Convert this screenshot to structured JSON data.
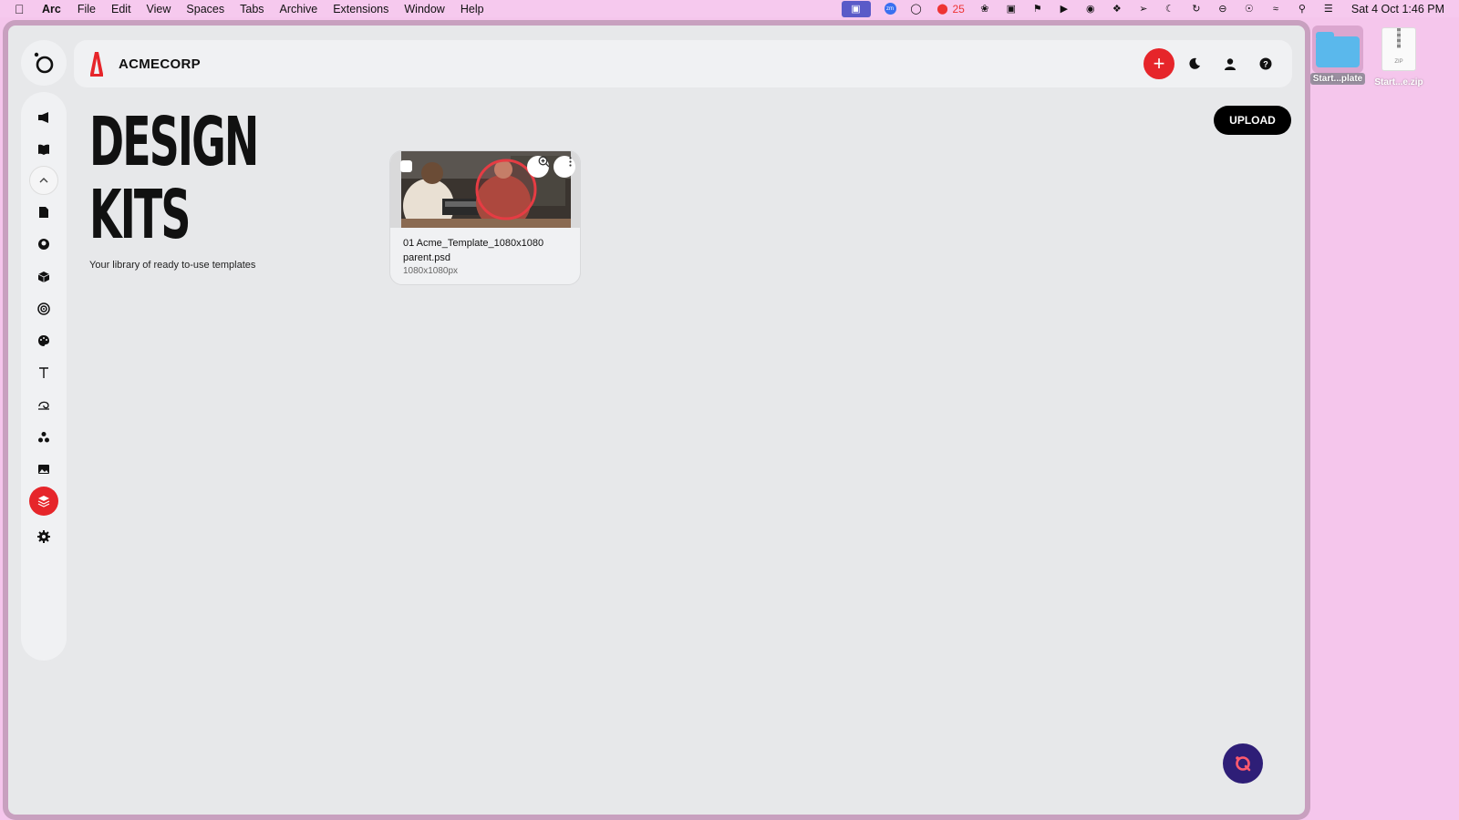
{
  "menubar": {
    "app": "Arc",
    "items": [
      "File",
      "Edit",
      "View",
      "Spaces",
      "Tabs",
      "Archive",
      "Extensions",
      "Window",
      "Help"
    ],
    "badge_count": "25",
    "clock": "Sat 4 Oct  1:46 PM"
  },
  "desktop": {
    "folder_label": "Start...plate",
    "zip_label": "Start...e.zip",
    "zip_tag": "ZIP"
  },
  "topbar": {
    "brand_name": "ACMECORP"
  },
  "page": {
    "title_line1": "DESIGN",
    "title_line2": "KITS",
    "subtitle": "Your library of ready to-use templates",
    "upload_label": "UPLOAD"
  },
  "card": {
    "name": "01 Acme_Template_1080x1080 parent.psd",
    "size": "1080x1080px"
  },
  "colors": {
    "accent": "#e6252a",
    "window_bg": "#e7e8ea",
    "fab": "#2e1e77",
    "desktop": "#f5c6ec"
  }
}
